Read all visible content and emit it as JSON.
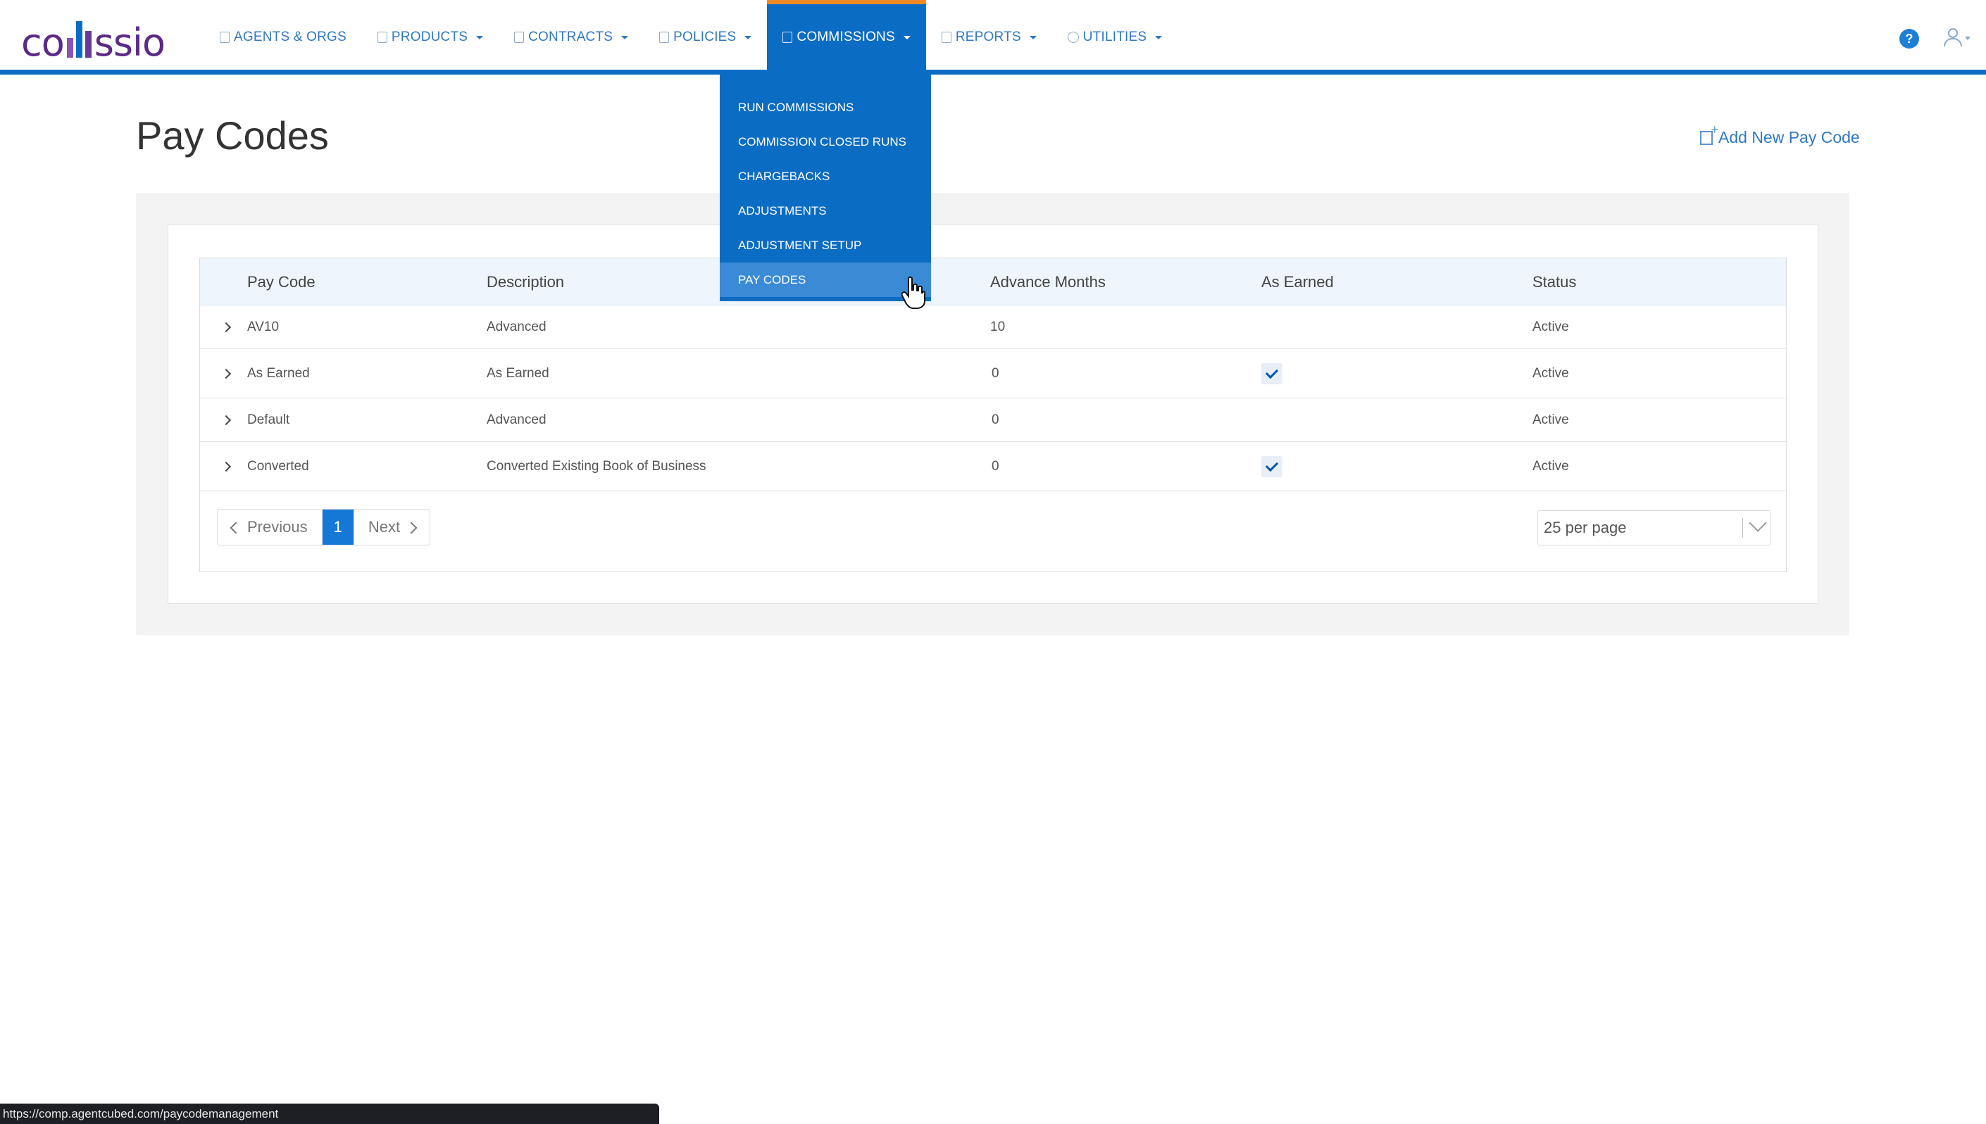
{
  "app": {
    "logo_text_left": "co",
    "logo_text_right": "ssio"
  },
  "nav": {
    "items": [
      {
        "label": "AGENTS & ORGS",
        "icon": "agents-icon",
        "caret": false
      },
      {
        "label": "PRODUCTS",
        "icon": "products-icon",
        "caret": true
      },
      {
        "label": "CONTRACTS",
        "icon": "contracts-icon",
        "caret": true
      },
      {
        "label": "POLICIES",
        "icon": "policies-icon",
        "caret": true
      },
      {
        "label": "COMMISSIONS",
        "icon": "commissions-icon",
        "caret": true,
        "active": true
      },
      {
        "label": "REPORTS",
        "icon": "reports-icon",
        "caret": true
      },
      {
        "label": "UTILITIES",
        "icon": "globe-icon",
        "caret": true
      }
    ],
    "help_label": "?"
  },
  "dropdown": {
    "items": [
      {
        "label": "RUN COMMISSIONS"
      },
      {
        "label": "COMMISSION CLOSED RUNS"
      },
      {
        "label": "CHARGEBACKS"
      },
      {
        "label": "ADJUSTMENTS"
      },
      {
        "label": "ADJUSTMENT SETUP"
      },
      {
        "label": "PAY CODES",
        "hover": true
      }
    ]
  },
  "page": {
    "title": "Pay Codes",
    "add_label": "Add New Pay Code"
  },
  "table": {
    "headers": {
      "pay_code": "Pay Code",
      "description": "Description",
      "advance_months": "Advance Months",
      "as_earned": "As Earned",
      "status": "Status"
    },
    "rows": [
      {
        "pay_code": "AV10",
        "description": "Advanced",
        "advance_months": "10",
        "as_earned": false,
        "status": "Active"
      },
      {
        "pay_code": "As Earned",
        "description": "As Earned",
        "advance_months": "0",
        "as_earned": true,
        "status": "Active"
      },
      {
        "pay_code": "Default",
        "description": "Advanced",
        "advance_months": "0",
        "as_earned": false,
        "status": "Active"
      },
      {
        "pay_code": "Converted",
        "description": "Converted Existing Book of Business",
        "advance_months": "0",
        "as_earned": true,
        "status": "Active"
      }
    ]
  },
  "pagination": {
    "previous_label": "Previous",
    "current_page": "1",
    "next_label": "Next",
    "per_page_label": "25 per page"
  },
  "statusbar": {
    "url": "https://comp.agentcubed.com/paycodemanagement"
  },
  "colors": {
    "accent": "#0b6cc4",
    "active_tab_top": "#f08a24",
    "brand": "#5b2a86"
  }
}
